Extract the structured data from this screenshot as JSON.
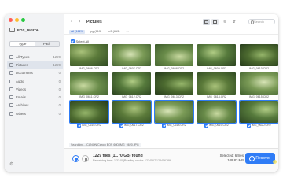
{
  "sidebar": {
    "drive_label": "EOS_DIGITAL",
    "tabs": [
      "Type",
      "Path"
    ],
    "categories": [
      {
        "label": "All Types",
        "count": "1229"
      },
      {
        "label": "Pictures",
        "count": "1229"
      },
      {
        "label": "Documents",
        "count": "0"
      },
      {
        "label": "Audio",
        "count": "0"
      },
      {
        "label": "Videos",
        "count": "0"
      },
      {
        "label": "Emails",
        "count": "0"
      },
      {
        "label": "Archives",
        "count": "0"
      },
      {
        "label": "Others",
        "count": "0"
      }
    ]
  },
  "toolbar": {
    "title": "Pictures",
    "search_placeholder": "Search"
  },
  "filters": [
    "All (1229)",
    "jpg (613)",
    "cr2 (613)",
    "..."
  ],
  "select_all_label": "Select All",
  "files": [
    "IMG_0606.CR2",
    "IMG_0607.CR2",
    "IMG_0608.CR2",
    "IMG_0609.CR2",
    "IMG_0610.CR2",
    "IMG_0611.CR2",
    "IMG_0612.CR2",
    "IMG_0613.CR2",
    "IMG_0614.CR2",
    "IMG_0615.CR2",
    "IMG_0616.CR2",
    "IMG_0617.CR2",
    "IMG_0618.CR2",
    "IMG_0619.CR2",
    "IMG_0620.CR2"
  ],
  "status": {
    "searching": "Searching.../CANON/Canon EOS 60D/IMG_0620.JPG",
    "found": "1229 files (11.70 GB) found",
    "remaining": "Remaining time: 1:33:00|Reading sector: 1234567/123456789",
    "selected": "Selected: 6 files",
    "selected_size": "109.83 MB",
    "recover_label": "Recover"
  }
}
